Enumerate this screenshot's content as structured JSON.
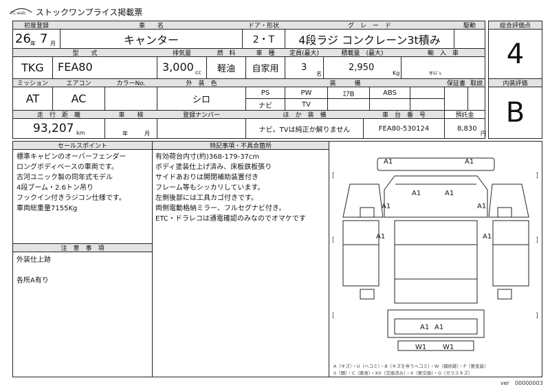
{
  "header": {
    "logo": "TC-web",
    "title": "ストックワンプライス掲載票"
  },
  "row1": {
    "h_reg": "初度登録",
    "h_name": "車　　名",
    "h_door": "ドア・形状",
    "h_grade": "グ　レ　ー　ド",
    "h_drive": "駆動",
    "reg_year": "26",
    "reg_year_unit": "年",
    "reg_month": "7",
    "reg_month_unit": "月",
    "name": "キャンター",
    "door": "2・T",
    "grade": "4段ラジ コンクレーン3t積み",
    "drive": ""
  },
  "row2": {
    "h_type": "型　　式",
    "h_disp": "排気量",
    "h_fuel": "燃　料",
    "h_use": "車　種",
    "h_cap": "定員(最大)",
    "h_load": "積載量　(最大)",
    "h_import": "輸　入　車",
    "type1": "TKG",
    "type2": "FEA80",
    "disp": "3,000",
    "disp_unit": "cc",
    "fuel": "軽油",
    "use": "自家用",
    "cap": "3",
    "cap_unit": "名",
    "load": "2,950",
    "load_unit": "Kg",
    "import_note": "年ﾓﾃﾞﾙ"
  },
  "row3": {
    "h_mission": "ミッション",
    "h_ac": "エアコン",
    "h_color_no": "カラーNo.",
    "h_color": "外　装　色",
    "h_equip": "装　　　備",
    "h_warranty": "保証書",
    "h_manual": "取説",
    "mission": "AT",
    "ac": "AC",
    "color_no": "",
    "color": "シロ",
    "equip": [
      "PS",
      "PW",
      "ｴｱB",
      "ABS",
      "ナビ",
      "TV",
      "",
      ""
    ]
  },
  "row4": {
    "h_mileage": "走　行　距　離",
    "h_inspect": "車　　検",
    "h_plate": "登録ナンバー",
    "h_other": "ほ　か　装　備",
    "h_vin": "車　台　番　号",
    "h_deposit": "預託金",
    "mileage": "93,207",
    "mileage_unit": "km",
    "inspect_year": "年",
    "inspect_month": "月",
    "plate": "",
    "other": "ナビ。TVは純正か解りません",
    "vin": "FEA80-530124",
    "deposit": "8,830",
    "deposit_unit": "円"
  },
  "score": {
    "h_total": "総合評価点",
    "total": "4",
    "h_interior": "内装評価",
    "interior": "B"
  },
  "sales": {
    "title": "セールスポイント",
    "text": "標準キャビンのオーバーフェンダー\nロングボディベースの車両です。\n古河ユニック製の同年式モデル\n4段ブーム・2.6トン吊り\nフックイン付きラジコン仕様です。\n車両総重量7155Kg"
  },
  "special": {
    "title": "特記事項・不具合箇所",
    "text": "有効荷台内寸(約)368-179-37cm\nボディ塗装仕上げ済み、床板鉄板張り\nサイドあおりは開閉補助装置付き\nフレーム等もシッカリしています。\n左側後部には工具カゴ付きです。\n両側電動格納ミラー、フルセグナビ付き。\nETC・ドラレコは通電確認のみなのでオマケです"
  },
  "caution": {
    "title": "注　意　事　項",
    "text": "外装仕上跡\n\n各所A有り"
  },
  "diagram": {
    "marks": [
      "A1",
      "A1",
      "A1",
      "A1",
      "A1",
      "A1",
      "A1",
      "A1",
      "A1",
      "A1",
      "W1",
      "W1"
    ],
    "brackets": [
      "[",
      "]",
      "[",
      "]",
      "[",
      "]"
    ],
    "legend1": "A（キズ）・U（ヘコミ）・B（キズを伴うヘコミ）・W（補修跡）・P（要塗装）",
    "legend2": "S（錆）・C（腐食）・XX（交換済み）・X（要交換）・G（ガラスキズ）"
  },
  "version": "ver　00000003"
}
